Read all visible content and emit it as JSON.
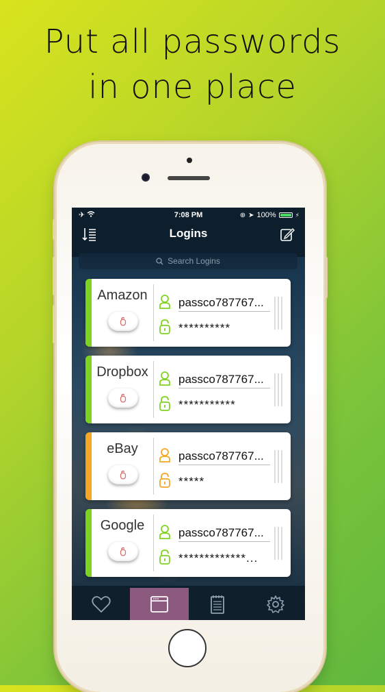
{
  "headline": {
    "line1": "Put all passwords",
    "line2": "in one place"
  },
  "status_bar": {
    "time": "7:08 PM",
    "battery": "100%"
  },
  "nav": {
    "title": "Logins"
  },
  "search": {
    "placeholder": "Search Logins"
  },
  "logins": [
    {
      "name": "Amazon",
      "username": "passco787767...",
      "password": "**********",
      "color": "#7ed321"
    },
    {
      "name": "Dropbox",
      "username": "passco787767...",
      "password": "***********",
      "color": "#7ed321"
    },
    {
      "name": "eBay",
      "username": "passco787767...",
      "password": "*****",
      "color": "#f5a623"
    },
    {
      "name": "Google",
      "username": "passco787767...",
      "password": "*************...",
      "color": "#7ed321"
    }
  ],
  "tabs": [
    {
      "icon": "heart-icon",
      "active": false
    },
    {
      "icon": "window-icon",
      "active": true
    },
    {
      "icon": "notepad-icon",
      "active": false
    },
    {
      "icon": "gear-icon",
      "active": false
    }
  ],
  "colors": {
    "accent_green": "#7ed321",
    "accent_orange": "#f5a623",
    "active_tab": "#8b5a7e"
  }
}
